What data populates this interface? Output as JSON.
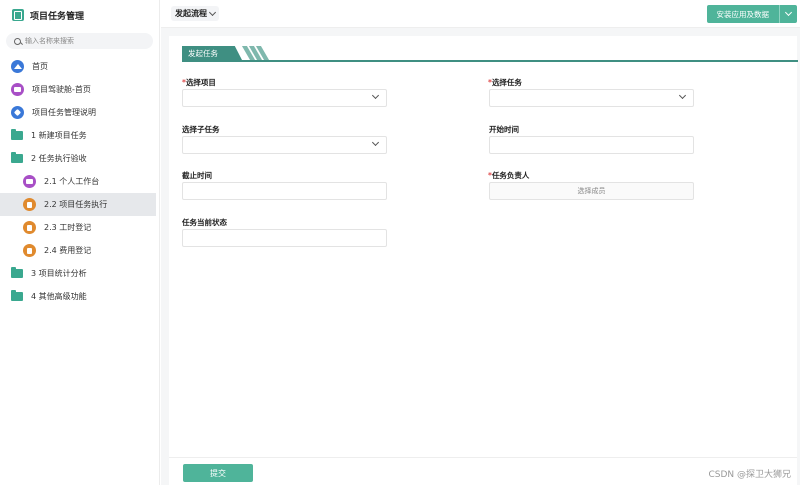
{
  "sidebar": {
    "app_title": "项目任务管理",
    "search_placeholder": "输入名称来搜索",
    "items": [
      {
        "label": "首页",
        "icon": "home-icon"
      },
      {
        "label": "项目驾驶舱-首页",
        "icon": "chat-icon"
      },
      {
        "label": "项目任务管理说明",
        "icon": "tag-icon"
      },
      {
        "label": "1 新建项目任务",
        "icon": "folder-icon"
      },
      {
        "label": "2 任务执行验收",
        "icon": "folder-icon"
      },
      {
        "label": "2.1 个人工作台",
        "icon": "chat-icon"
      },
      {
        "label": "2.2 项目任务执行",
        "icon": "document-icon",
        "active": true
      },
      {
        "label": "2.3 工时登记",
        "icon": "document-icon"
      },
      {
        "label": "2.4 费用登记",
        "icon": "document-icon"
      },
      {
        "label": "3 项目统计分析",
        "icon": "folder-icon"
      },
      {
        "label": "4 其他高级功能",
        "icon": "folder-icon"
      }
    ]
  },
  "topbar": {
    "flow_label": "发起流程",
    "install_label": "安装应用及数据"
  },
  "form": {
    "section_title": "发起任务",
    "fields": {
      "project": {
        "label": "选择项目",
        "required": true
      },
      "task": {
        "label": "选择任务",
        "required": true
      },
      "subtask": {
        "label": "选择子任务"
      },
      "start_time": {
        "label": "开始时间"
      },
      "end_time": {
        "label": "截止时间"
      },
      "owner": {
        "label": "任务负责人",
        "required": true,
        "placeholder": "选择成员"
      },
      "status": {
        "label": "任务当前状态"
      }
    },
    "required_mark": "*",
    "submit_label": "提交"
  },
  "watermark": "CSDN @探卫大狮兄",
  "colors": {
    "accent": "#4fb49a",
    "section": "#3f8f82"
  }
}
